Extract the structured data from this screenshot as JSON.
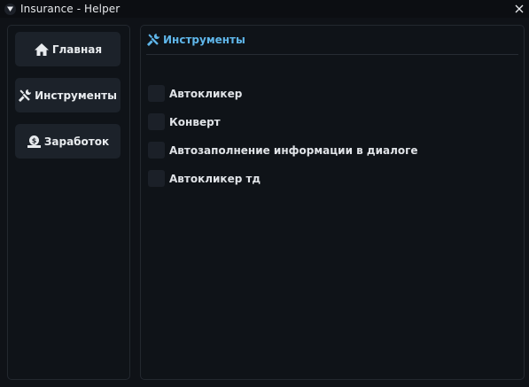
{
  "window": {
    "title": "Insurance - Helper",
    "accent_color": "#5fb6ea",
    "background_color": "#0f1217",
    "button_color": "#1c222a"
  },
  "sidebar": {
    "items": [
      {
        "label": "Главная",
        "icon": "home-icon"
      },
      {
        "label": "Инструменты",
        "icon": "tools-icon"
      },
      {
        "label": "Заработок",
        "icon": "money-icon"
      }
    ]
  },
  "main": {
    "header": {
      "title": "Инструменты",
      "icon": "tools-icon"
    },
    "options": [
      {
        "label": "Автокликер",
        "checked": false
      },
      {
        "label": "Конверт",
        "checked": false
      },
      {
        "label": "Автозаполнение информации в диалоге",
        "checked": false
      },
      {
        "label": "Автокликер тд",
        "checked": false
      }
    ]
  }
}
